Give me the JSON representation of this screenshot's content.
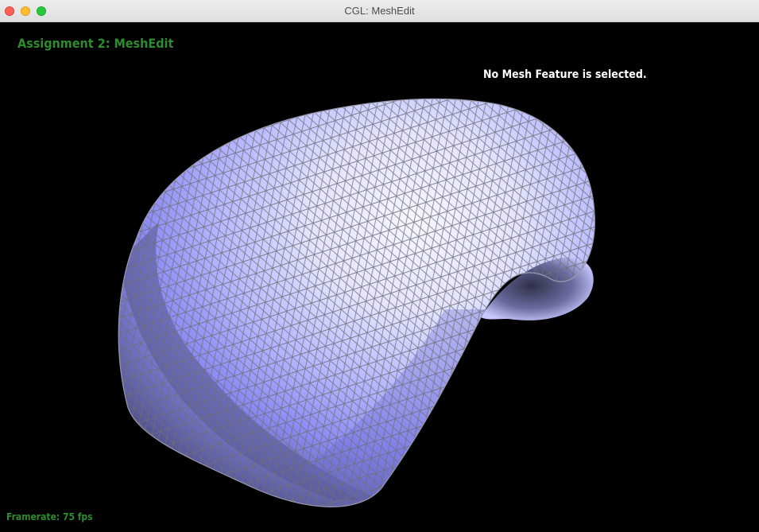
{
  "window": {
    "title": "CGL: MeshEdit",
    "buttons": [
      "close",
      "minimize",
      "zoom"
    ]
  },
  "hud": {
    "assignment_title": "Assignment 2: MeshEdit",
    "selection_status": "No Mesh Feature is selected.",
    "framerate": "Framerate: 75 fps"
  },
  "colors": {
    "background": "#000000",
    "hud_green": "#2e8b2e",
    "mesh_highlight": "#f4f4ff",
    "mesh_base": "#8c8cff",
    "mesh_shadow": "#55558f",
    "wireframe": "#6e6e78"
  }
}
